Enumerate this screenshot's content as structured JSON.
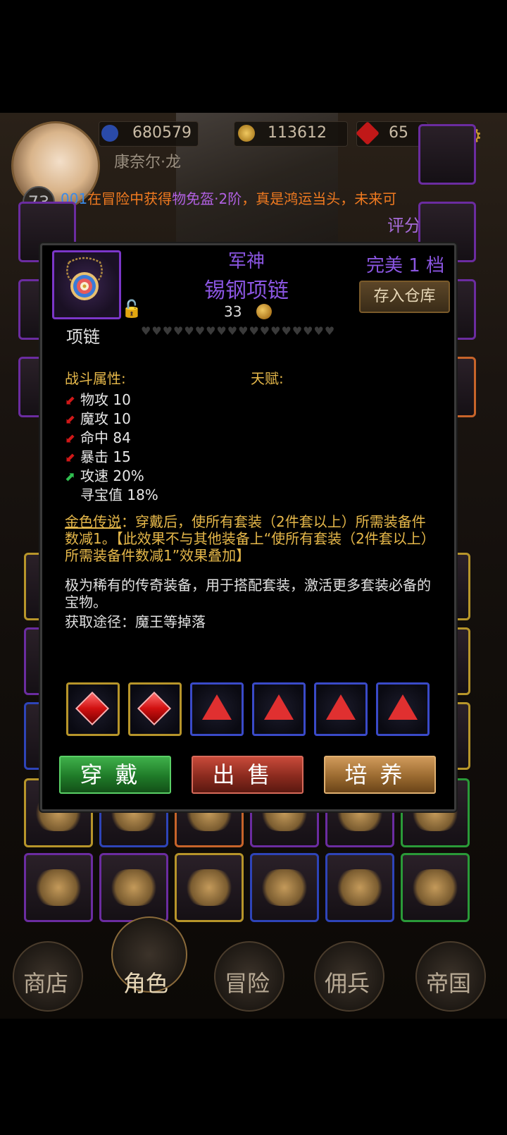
{
  "topbar": {
    "exp_value": "680579",
    "gold_value": "113612",
    "gem_value": "65",
    "char_name": "康奈尔·龙",
    "level": "73",
    "ticker_prefix": "001",
    "ticker_mid": "在冒险中获得",
    "ticker_item": "物免盔·2阶",
    "ticker_suffix": "，真是鸿运当头，未来可",
    "score": "评分:110"
  },
  "item": {
    "prefix": "军神",
    "name": "锡钢项链",
    "level": "33",
    "quality": "完美 1 档",
    "store_label": "存入仓库",
    "type": "项链",
    "hearts": "♥♥♥♥♥♥♥♥♥♥♥♥♥♥♥♥♥♥",
    "combat_title": "战斗属性:",
    "talent_title": "天赋:",
    "stats": [
      {
        "text": "物攻 10",
        "arrow": "down"
      },
      {
        "text": "魔攻 10",
        "arrow": "down"
      },
      {
        "text": "命中 84",
        "arrow": "down"
      },
      {
        "text": "暴击 15",
        "arrow": "down"
      },
      {
        "text": "攻速 20%",
        "arrow": "up"
      },
      {
        "text": "寻宝值 18%",
        "arrow": "none"
      }
    ],
    "legend_label": "金色传说",
    "legend_text": "：穿戴后，使所有套装（2件套以上）所需装备件数减1。【此效果不与其他装备上“使所有套装（2件套以上）所需装备件数减1”效果叠加】",
    "description": "极为稀有的传奇装备，用于搭配套装，激活更多套装必备的宝物。",
    "source": "获取途径：魔王等掉落"
  },
  "sockets": [
    {
      "frame": "yellow",
      "gem": "diamond"
    },
    {
      "frame": "yellow",
      "gem": "diamond"
    },
    {
      "frame": "blue",
      "gem": "triangle"
    },
    {
      "frame": "blue",
      "gem": "triangle"
    },
    {
      "frame": "blue",
      "gem": "triangle"
    },
    {
      "frame": "blue",
      "gem": "triangle"
    }
  ],
  "actions": {
    "equip": "穿戴",
    "sell": "出售",
    "train": "培养"
  },
  "nav": {
    "shop": "商店",
    "character": "角色",
    "adventure": "冒险",
    "mercenary": "佣兵",
    "empire": "帝国"
  },
  "colors": {
    "epic_purple": "#8a55e0",
    "legend_gold": "#e6b84a",
    "stat_down_red": "#d01818",
    "stat_up_green": "#30c050"
  }
}
